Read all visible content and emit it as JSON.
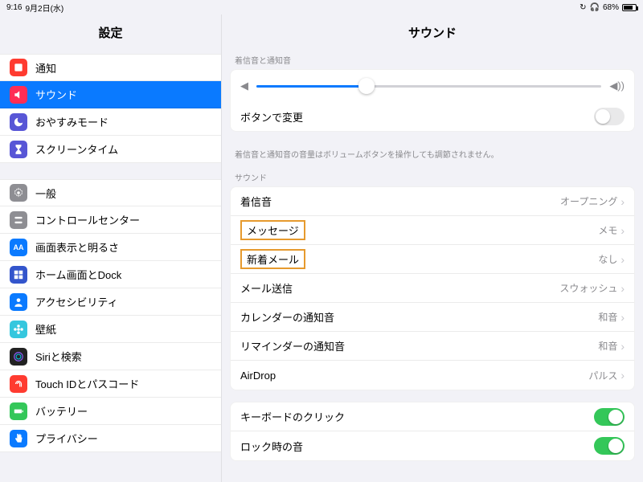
{
  "status": {
    "time": "9:16",
    "date": "9月2日(水)",
    "battery_pct": "68%"
  },
  "sidebar": {
    "title": "設定",
    "group1": [
      {
        "label": "通知",
        "icon_bg": "#ff3b30",
        "icon": "bell-square-icon"
      },
      {
        "label": "サウンド",
        "icon_bg": "#ff2d55",
        "icon": "speaker-icon",
        "selected": true
      },
      {
        "label": "おやすみモード",
        "icon_bg": "#5856d6",
        "icon": "moon-icon"
      },
      {
        "label": "スクリーンタイム",
        "icon_bg": "#5856d6",
        "icon": "hourglass-icon"
      }
    ],
    "group2": [
      {
        "label": "一般",
        "icon_bg": "#8e8e93",
        "icon": "gear-icon"
      },
      {
        "label": "コントロールセンター",
        "icon_bg": "#8e8e93",
        "icon": "switches-icon"
      },
      {
        "label": "画面表示と明るさ",
        "icon_bg": "#0a7aff",
        "icon": "aa-icon",
        "icon_text": "AA"
      },
      {
        "label": "ホーム画面とDock",
        "icon_bg": "#3355cc",
        "icon": "grid-icon"
      },
      {
        "label": "アクセシビリティ",
        "icon_bg": "#0a7aff",
        "icon": "person-icon"
      },
      {
        "label": "壁紙",
        "icon_bg": "#35c7de",
        "icon": "flower-icon"
      },
      {
        "label": "Siriと検索",
        "icon_bg": "#222222",
        "icon": "siri-icon"
      },
      {
        "label": "Touch IDとパスコード",
        "icon_bg": "#ff3b30",
        "icon": "touchid-icon"
      },
      {
        "label": "バッテリー",
        "icon_bg": "#34c759",
        "icon": "battery-icon"
      },
      {
        "label": "プライバシー",
        "icon_bg": "#0a7aff",
        "icon": "hand-icon"
      }
    ]
  },
  "detail": {
    "title": "サウンド",
    "ringer_header": "着信音と通知音",
    "change_with_buttons": "ボタンで変更",
    "ringer_footer": "着信音と通知音の音量はボリュームボタンを操作しても調節されません。",
    "sounds_header": "サウンド",
    "rows": {
      "ringtone": {
        "label": "着信音",
        "value": "オープニング"
      },
      "text_tone": {
        "label": "メッセージ",
        "value": "メモ"
      },
      "new_mail": {
        "label": "新着メール",
        "value": "なし"
      },
      "sent_mail": {
        "label": "メール送信",
        "value": "スウォッシュ"
      },
      "calendar": {
        "label": "カレンダーの通知音",
        "value": "和音"
      },
      "reminder": {
        "label": "リマインダーの通知音",
        "value": "和音"
      },
      "airdrop": {
        "label": "AirDrop",
        "value": "パルス"
      }
    },
    "keyboard_clicks": "キーボードのクリック",
    "lock_sound": "ロック時の音"
  }
}
